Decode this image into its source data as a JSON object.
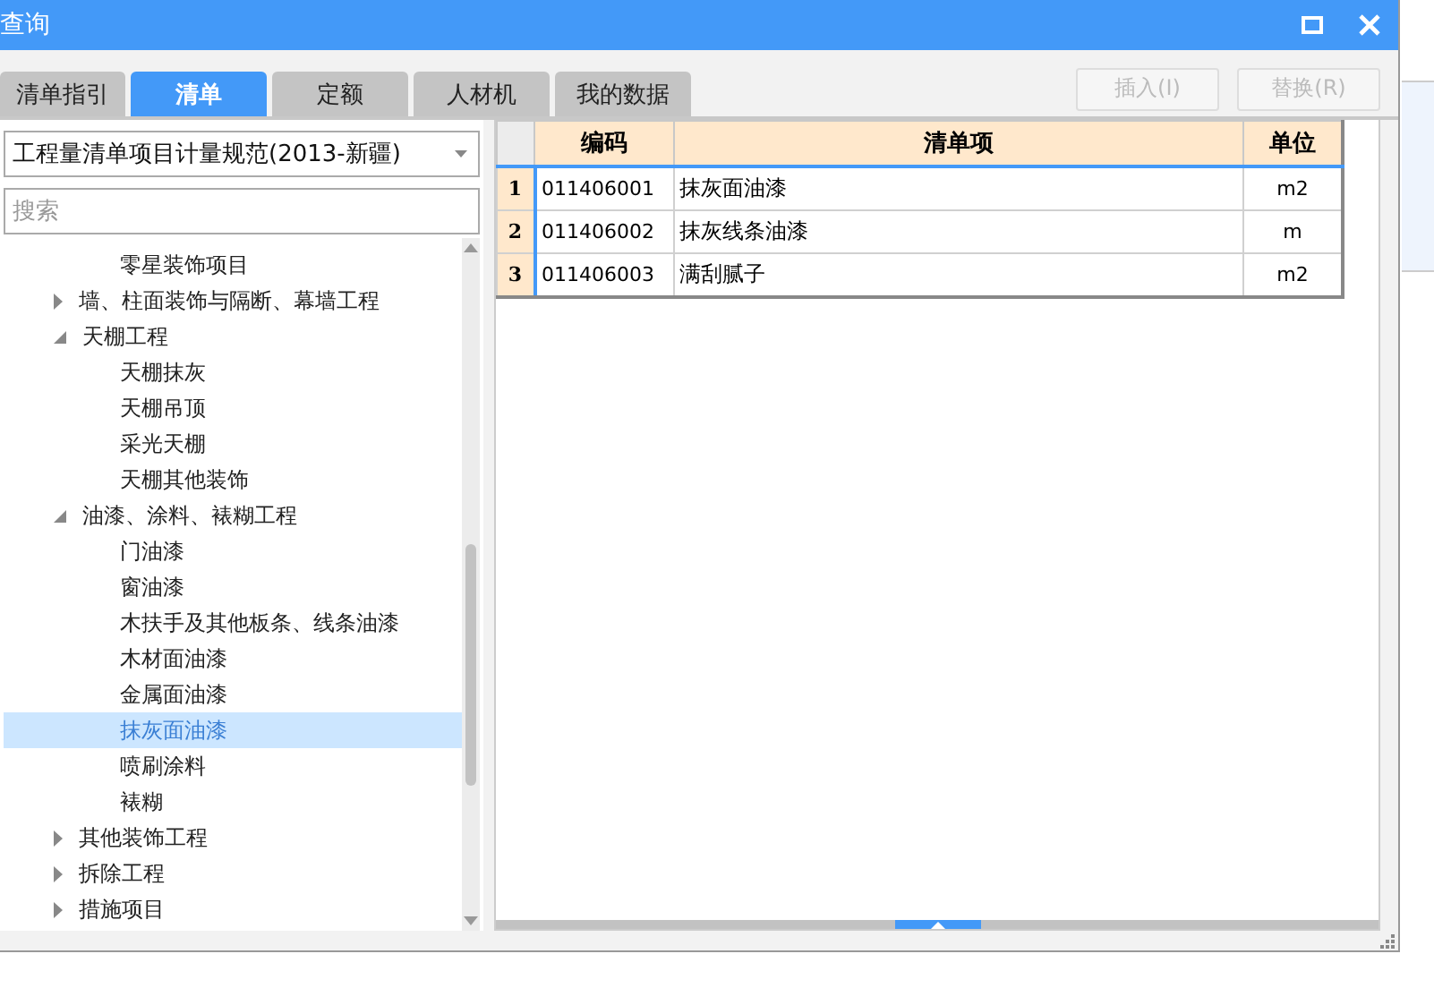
{
  "window": {
    "title": "查询"
  },
  "tabs": [
    {
      "label": "清单指引",
      "selected": false
    },
    {
      "label": "清单",
      "selected": true
    },
    {
      "label": "定额",
      "selected": false
    },
    {
      "label": "人材机",
      "selected": false
    },
    {
      "label": "我的数据",
      "selected": false
    }
  ],
  "buttons": [
    {
      "label": "插入(I)",
      "disabled": true
    },
    {
      "label": "替换(R)",
      "disabled": true
    }
  ],
  "library_select": {
    "value": "工程量清单项目计量规范(2013-新疆)"
  },
  "search": {
    "placeholder": "搜索"
  },
  "tree": {
    "partial_branch": [
      {
        "label": "零星装饰项目",
        "selected": false
      }
    ],
    "nodes": [
      {
        "label": "墙、柱面装饰与隔断、幕墙工程",
        "expanded": false
      },
      {
        "label": "天棚工程",
        "expanded": true,
        "children": [
          {
            "label": "天棚抹灰",
            "selected": false
          },
          {
            "label": "天棚吊顶",
            "selected": false
          },
          {
            "label": "采光天棚",
            "selected": false
          },
          {
            "label": "天棚其他装饰",
            "selected": false
          }
        ]
      },
      {
        "label": "油漆、涂料、裱糊工程",
        "expanded": true,
        "children": [
          {
            "label": "门油漆",
            "selected": false
          },
          {
            "label": "窗油漆",
            "selected": false
          },
          {
            "label": "木扶手及其他板条、线条油漆",
            "selected": false
          },
          {
            "label": "木材面油漆",
            "selected": false
          },
          {
            "label": "金属面油漆",
            "selected": false
          },
          {
            "label": "抹灰面油漆",
            "selected": true
          },
          {
            "label": "喷刷涂料",
            "selected": false
          },
          {
            "label": "裱糊",
            "selected": false
          }
        ]
      },
      {
        "label": "其他装饰工程",
        "expanded": false
      },
      {
        "label": "拆除工程",
        "expanded": false
      },
      {
        "label": "措施项目",
        "expanded": false
      }
    ]
  },
  "table": {
    "columns": [
      "编码",
      "清单项",
      "单位"
    ],
    "rows": [
      {
        "index": "1",
        "cells": [
          "011406001",
          "抹灰面油漆",
          "m2"
        ]
      },
      {
        "index": "2",
        "cells": [
          "011406002",
          "抹灰线条油漆",
          "m"
        ]
      },
      {
        "index": "3",
        "cells": [
          "011406003",
          "满刮腻子",
          "m2"
        ]
      }
    ]
  }
}
